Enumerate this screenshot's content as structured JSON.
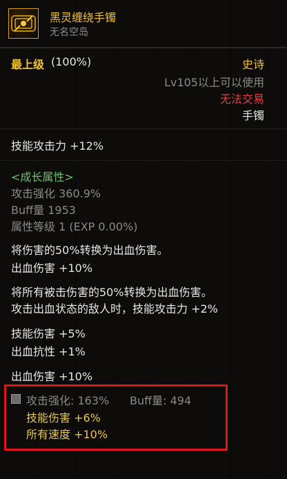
{
  "item": {
    "name": "黑灵缠绕手镯",
    "source": "无名空岛",
    "icon": "dark-bracelet-icon"
  },
  "rarity": {
    "level_label": "最上级",
    "level_percent": "(100%)",
    "grade": "史诗"
  },
  "requirement": "Lv105以上可以使用",
  "trade_status": "无法交易",
  "item_type": "手镯",
  "base_stat": "技能攻击力  +12%",
  "growth": {
    "title": "<成长属性>",
    "attack_boost": "攻击强化 360.9%",
    "buff": "Buff量 1953",
    "attr_level": "属性等级 1 (EXP 0.00%)"
  },
  "effects": {
    "line1": "将伤害的50%转换为出血伤害。",
    "line2": "出血伤害 +10%",
    "line3": "将所有被击伤害的50%转换为出血伤害。",
    "line4": "攻击出血状态的敌人时，技能攻击力 +2%",
    "line5": "技能伤害 +5%",
    "line6": "出血抗性 +1%",
    "line7": "出血伤害 +10%"
  },
  "set_bonus": {
    "attack_boost": "攻击强化: 163%",
    "buff": "Buff量: 494",
    "line1": "技能伤害 +6%",
    "line2": "所有速度 +10%"
  },
  "colors": {
    "name": "#f0c23a",
    "epic": "#f0c23a",
    "untradeable": "#e24040",
    "growth": "#6fbf6f",
    "highlight_box": "#e01515"
  }
}
